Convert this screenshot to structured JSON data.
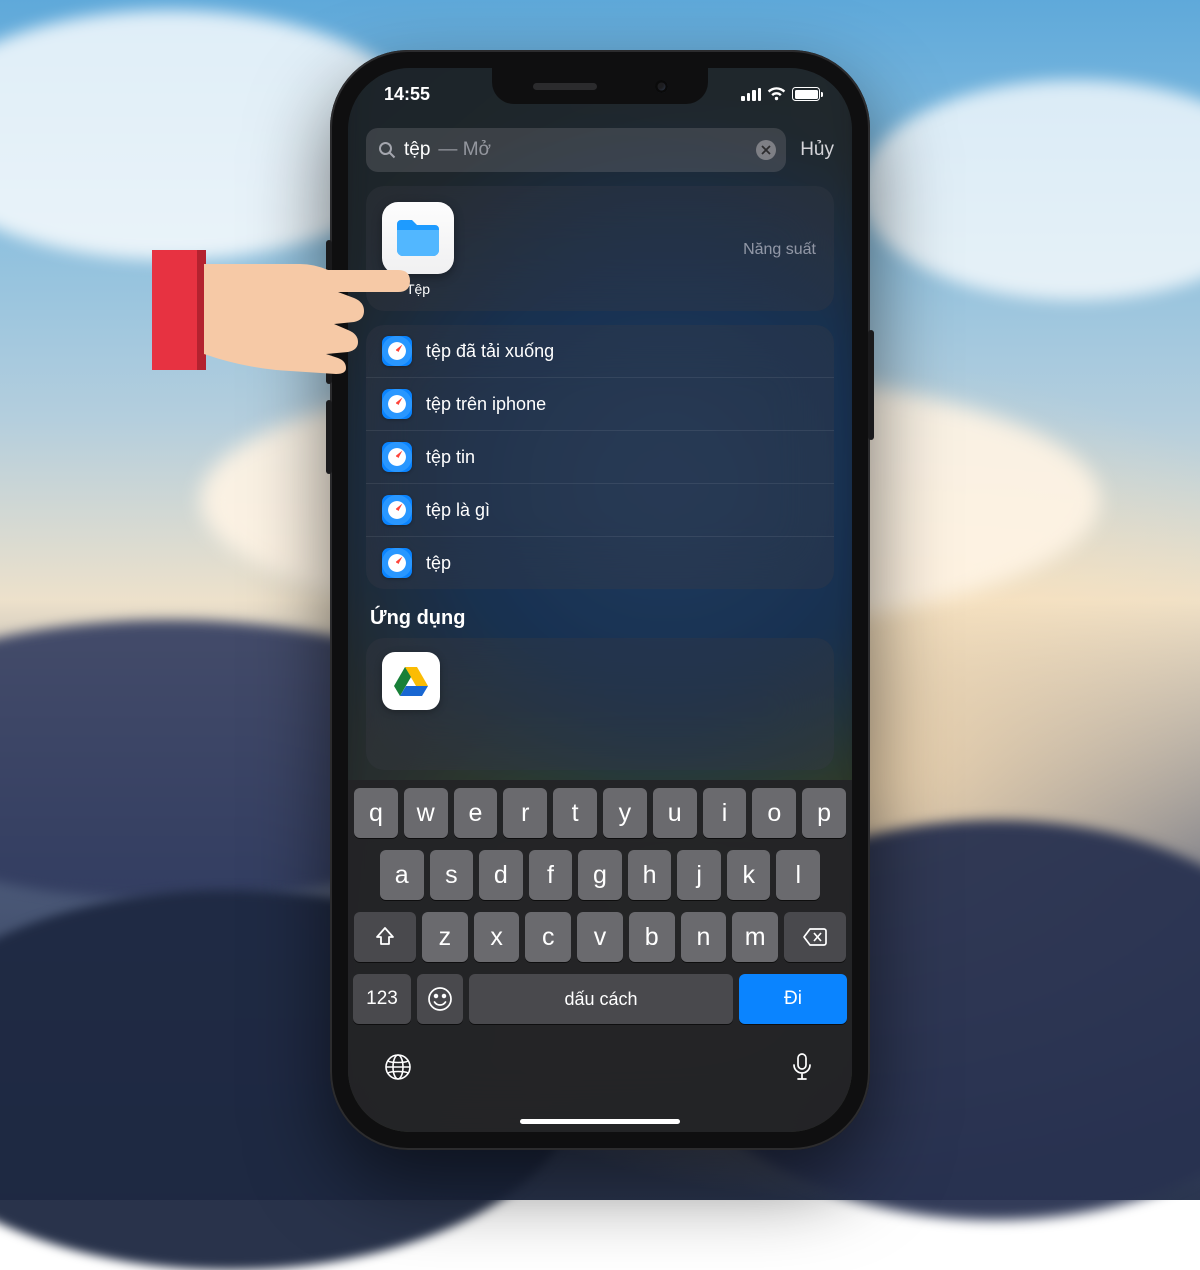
{
  "status": {
    "time": "14:55"
  },
  "search": {
    "query": "tệp",
    "hint_suffix": " — Mở",
    "cancel": "Hủy"
  },
  "top_hit": {
    "app_name": "Tệp",
    "category": "Năng suất"
  },
  "suggestions": [
    {
      "text": "tệp đã tải xuống"
    },
    {
      "text": "tệp trên iphone"
    },
    {
      "text": "tệp tin"
    },
    {
      "text": "tệp là gì"
    },
    {
      "text": "tệp"
    }
  ],
  "sections": {
    "apps": "Ứng dụng"
  },
  "keyboard": {
    "row1": [
      "q",
      "w",
      "e",
      "r",
      "t",
      "y",
      "u",
      "i",
      "o",
      "p"
    ],
    "row2": [
      "a",
      "s",
      "d",
      "f",
      "g",
      "h",
      "j",
      "k",
      "l"
    ],
    "row3": [
      "z",
      "x",
      "c",
      "v",
      "b",
      "n",
      "m"
    ],
    "numbers": "123",
    "space": "dấu cách",
    "go": "Đi"
  }
}
